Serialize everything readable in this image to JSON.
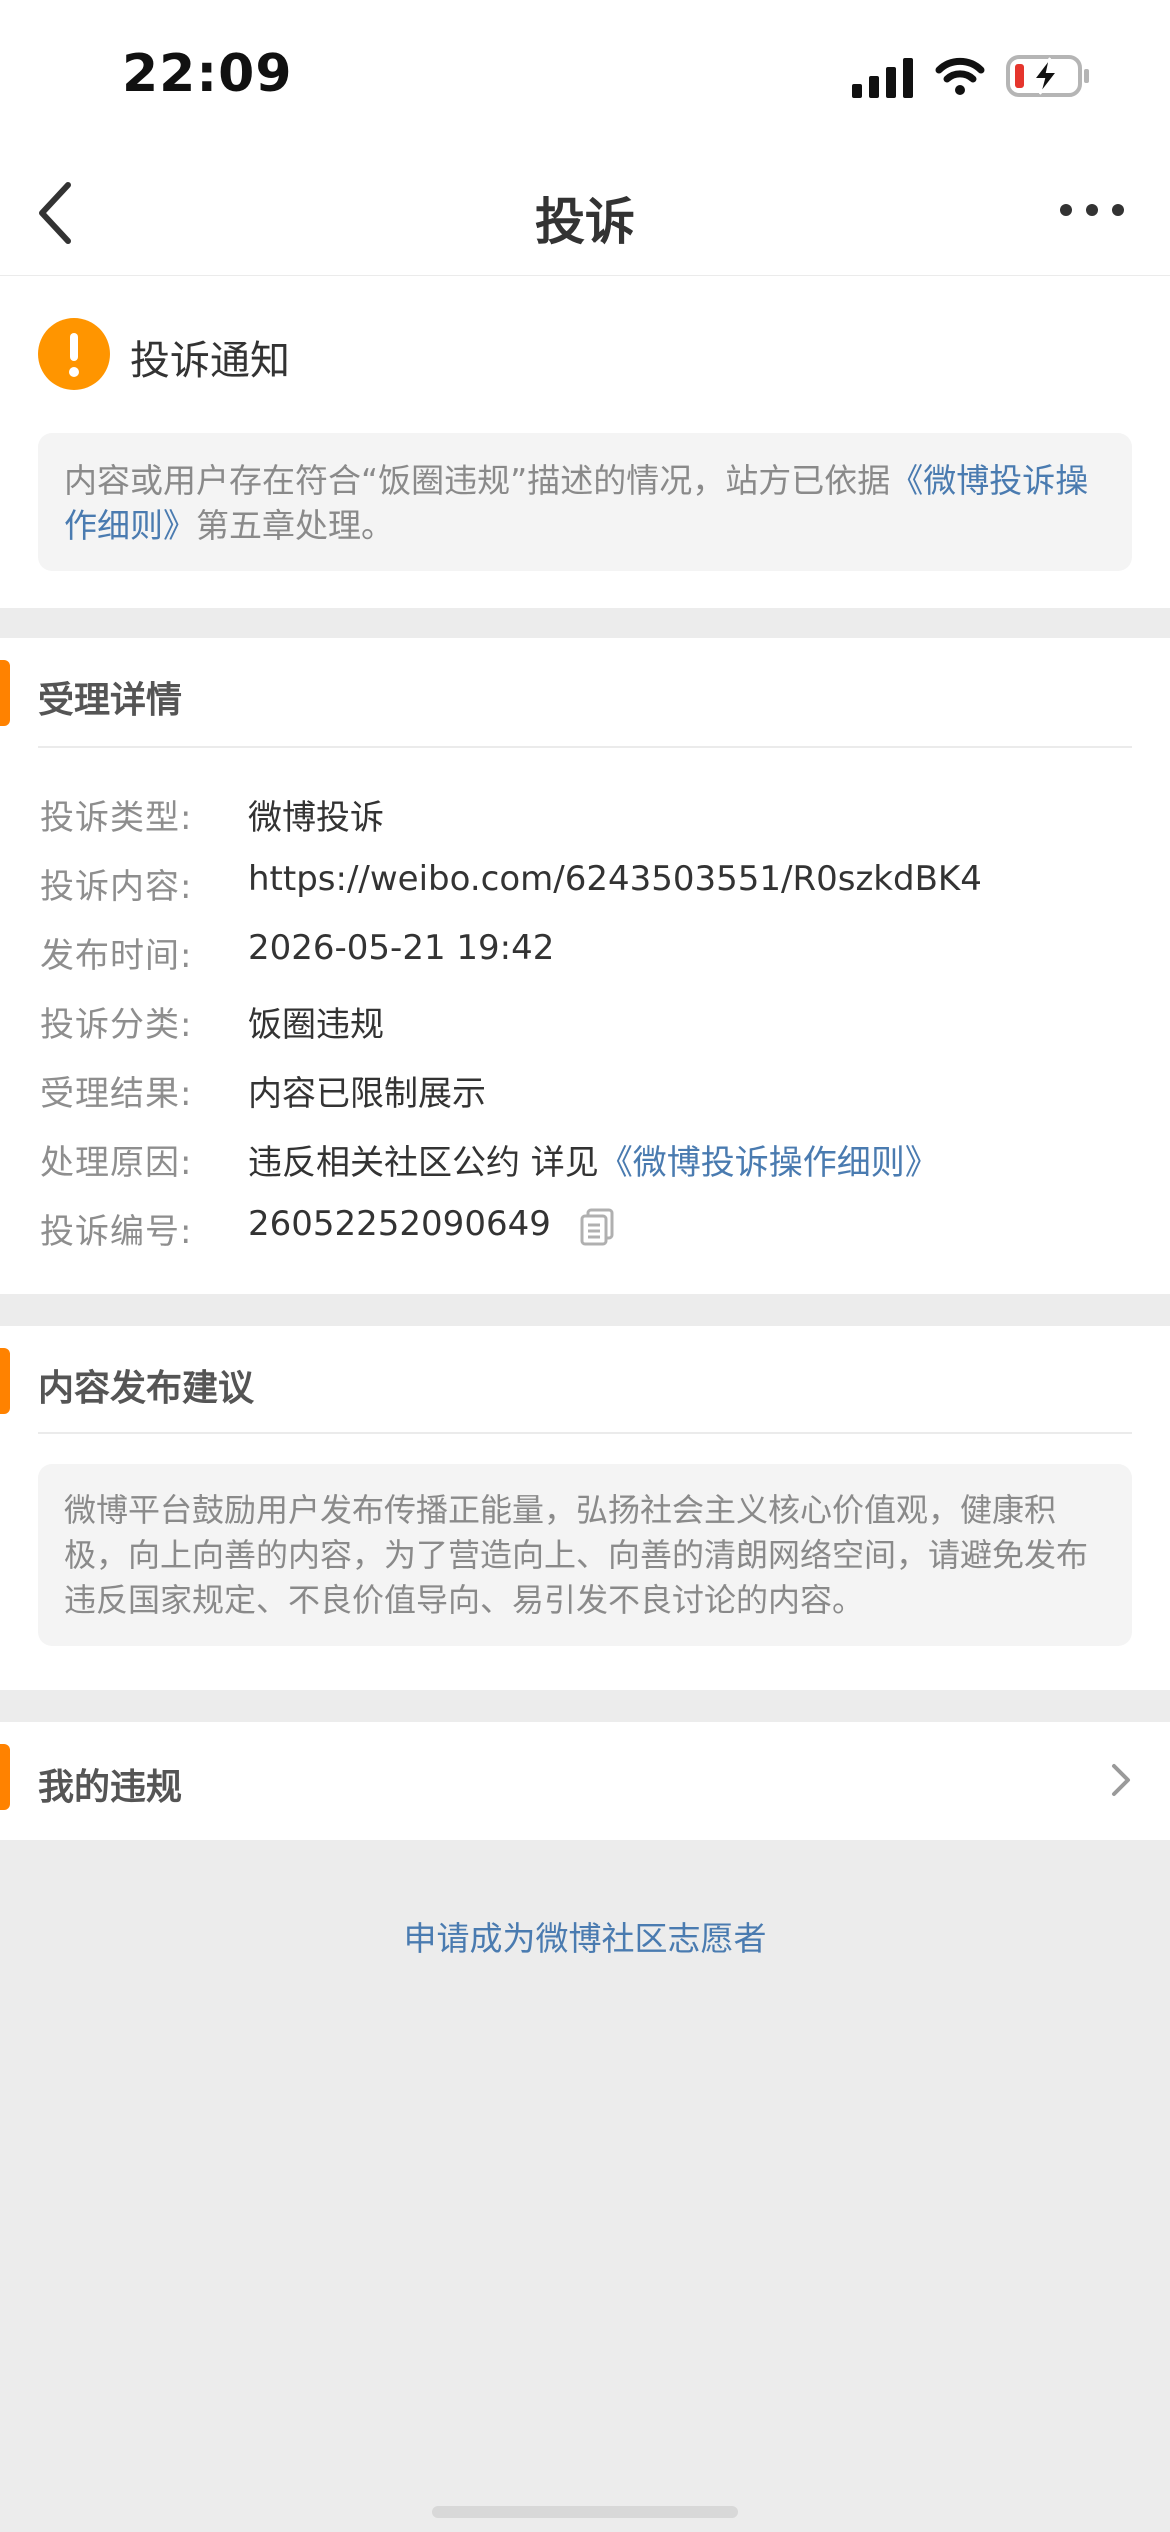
{
  "status_bar": {
    "time": "22:09"
  },
  "nav": {
    "title": "投诉"
  },
  "notice": {
    "title": "投诉通知",
    "text_prefix": "内容或用户存在符合“饭圈违规”描述的情况，站方已依据",
    "link": "《微博投诉操作细则》",
    "text_suffix": "第五章处理。"
  },
  "details": {
    "title": "受理详情",
    "rows": [
      {
        "label": "投诉类型:",
        "value": "微博投诉"
      },
      {
        "label": "投诉内容:",
        "value": "https://weibo.com/6243503551/R0szkdBK4"
      },
      {
        "label": "发布时间:",
        "value": "2026-05-21 19:42"
      },
      {
        "label": "投诉分类:",
        "value": "饭圈违规"
      },
      {
        "label": "受理结果:",
        "value": "内容已限制展示"
      },
      {
        "label": "处理原因:",
        "value": "违反相关社区公约 详见",
        "link": "《微博投诉操作细则》"
      },
      {
        "label": "投诉编号:",
        "value": "26052252090649"
      }
    ]
  },
  "advice": {
    "title": "内容发布建议",
    "text": "微博平台鼓励用户发布传播正能量，弘扬社会主义核心价值观，健康积极，向上向善的内容，为了营造向上、向善的清朗网络空间，请避免发布违反国家规定、不良价值导向、易引发不良讨论的内容。"
  },
  "violations": {
    "title": "我的违规"
  },
  "volunteer": {
    "label": "申请成为微博社区志愿者"
  },
  "colors": {
    "accent": "#ff8200",
    "link": "#4a7bb0",
    "background": "#ececec"
  },
  "icons": [
    "signal-icon",
    "wifi-icon",
    "battery-charging-icon",
    "back-icon",
    "more-icon",
    "warning-icon",
    "copy-icon",
    "chevron-right-icon"
  ]
}
